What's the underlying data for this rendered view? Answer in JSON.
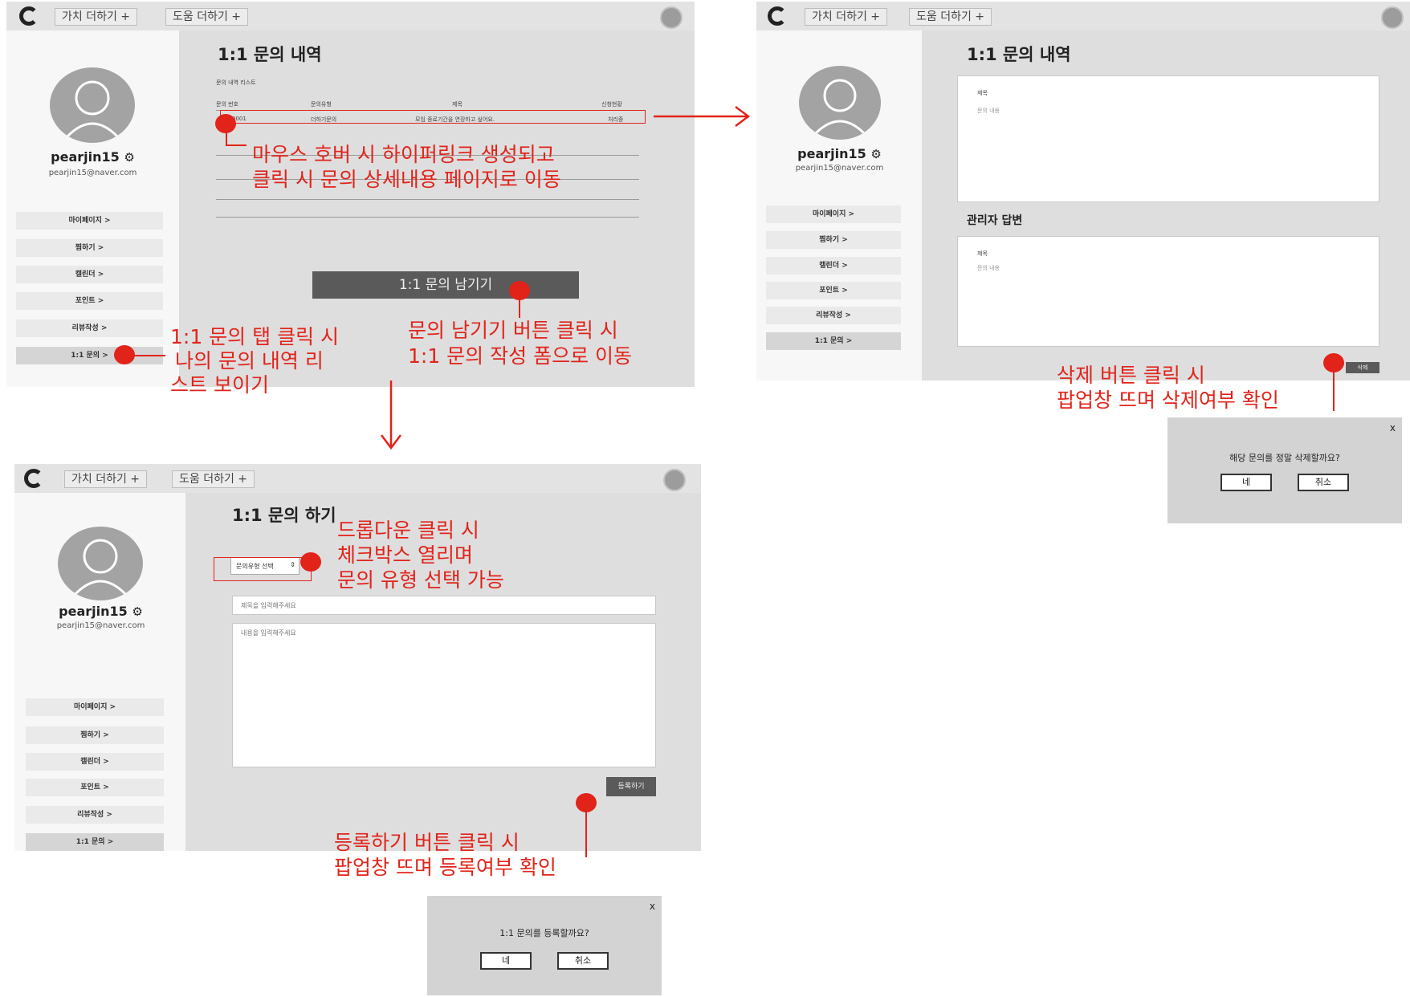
{
  "topbar": {
    "menu1": "가치 더하기 +",
    "menu2": "도움 더하기 +"
  },
  "profile": {
    "username": "pearjin15",
    "email": "pearjin15@naver.com",
    "gear": "⚙"
  },
  "sidebar": {
    "items": [
      "마이페이지 >",
      "찜하기 >",
      "캘린더 >",
      "포인트 >",
      "리뷰작성 >",
      "1:1 문의 >"
    ]
  },
  "screen_list": {
    "title": "1:1 문의 내역",
    "subtitle": "문의 내역 리스트",
    "columns": [
      "문의 번호",
      "문의유형",
      "제목",
      "신청현황"
    ],
    "rows": [
      [
        "0001",
        "더하기문의",
        "모임 종료기간을 연장하고 싶어요.",
        "처리중"
      ]
    ],
    "write_button": "1:1 문의 남기기"
  },
  "screen_detail": {
    "title": "1:1 문의 내역",
    "question_title": "제목",
    "question_body": "문의 내용",
    "answer_heading": "관리자 답변",
    "answer_title": "제목",
    "answer_body": "문의 내용",
    "delete_button": "삭제"
  },
  "screen_form": {
    "title": "1:1 문의 하기",
    "select_value": "문의유형 선택",
    "title_placeholder": "제목을 입력해주세요",
    "body_placeholder": "내용을 입력해주세요",
    "submit_button": "등록하기"
  },
  "popup_delete": {
    "close": "x",
    "message": "해당 문의를 정말 삭제할까요?",
    "yes": "네",
    "no": "취소"
  },
  "popup_submit": {
    "close": "x",
    "message": "1:1 문의를 등록할까요?",
    "yes": "네",
    "no": "취소"
  },
  "annotations": {
    "hover_1": "마우스 호버 시 하이퍼링크 생성되고",
    "hover_2": "클릭 시 문의 상세내용 페이지로 이동",
    "tab_1": "1:1 문의 탭 클릭 시",
    "tab_2": "나의 문의 내역 리",
    "tab_3": "스트 보이기",
    "write_1": "문의 남기기 버튼 클릭 시",
    "write_2": "1:1 문의 작성 폼으로 이동",
    "delete_1": "삭제 버튼 클릭 시",
    "delete_2": "팝업창 뜨며 삭제여부 확인",
    "dropdown_1": "드롭다운 클릭 시",
    "dropdown_2": "체크박스 열리며",
    "dropdown_3": "문의 유형 선택 가능",
    "submit_1": "등록하기 버튼 클릭 시",
    "submit_2": "팝업창 뜨며 등록여부 확인"
  },
  "colors": {
    "annotation": "#e2231a",
    "dark_button": "#5a5a5a"
  }
}
